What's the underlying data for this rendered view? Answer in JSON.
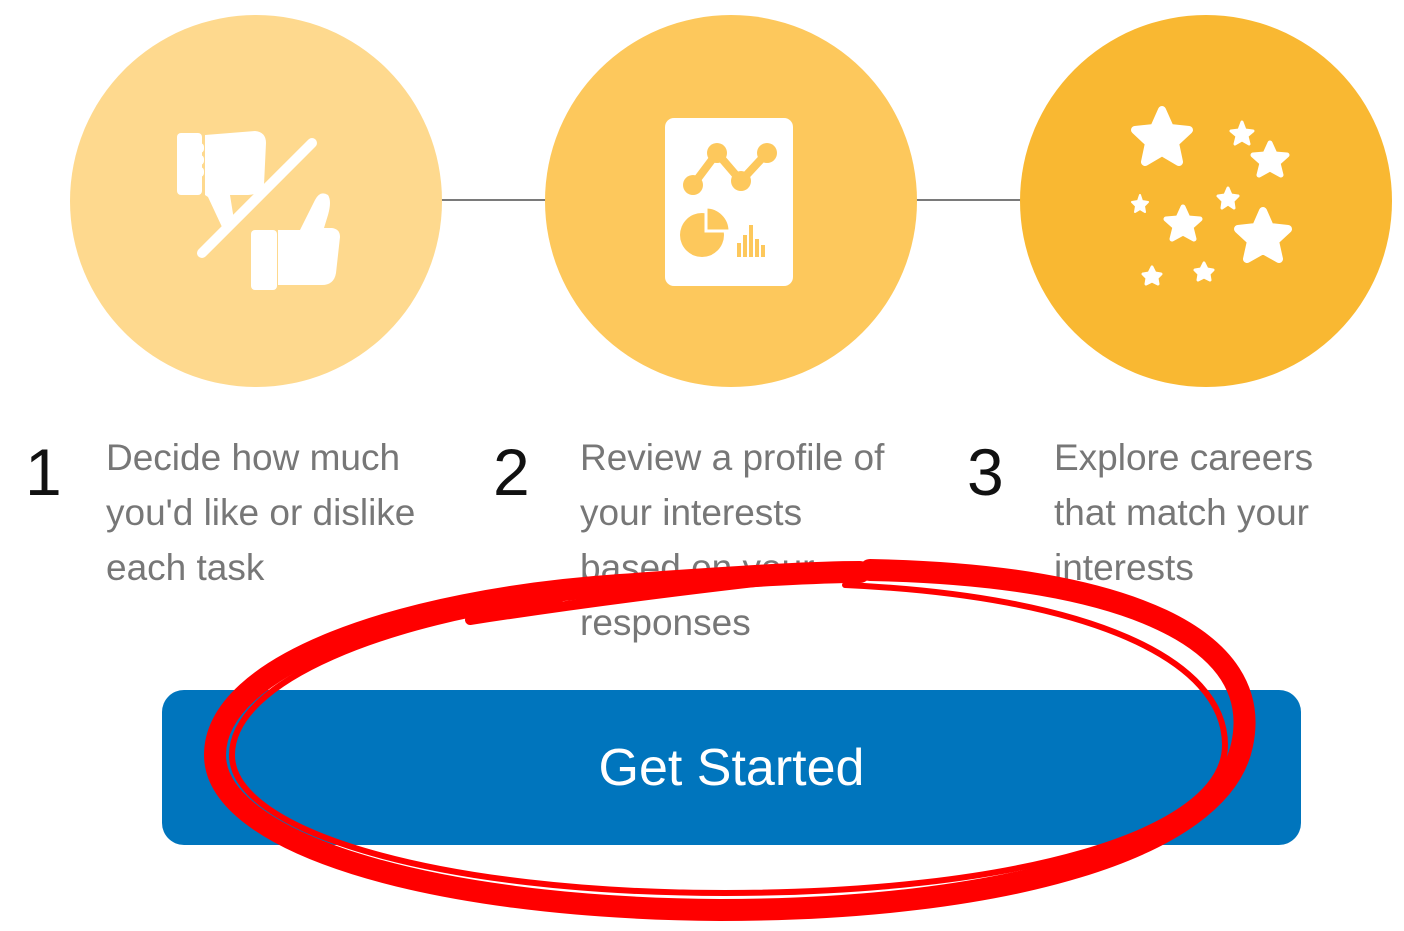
{
  "steps": [
    {
      "number": "1",
      "description": "Decide how much you'd like or dislike each task",
      "icon": "thumbs-down-up-icon",
      "color": "#fed98e"
    },
    {
      "number": "2",
      "description": "Review a profile of your interests based on your responses",
      "icon": "report-chart-icon",
      "color": "#fdc85c"
    },
    {
      "number": "3",
      "description": "Explore careers that match your interests",
      "icon": "stars-icon",
      "color": "#f9b832"
    }
  ],
  "cta": {
    "label": "Get Started",
    "color": "#0075bd"
  },
  "annotation": {
    "color": "#ff0000",
    "shape": "ellipse"
  }
}
